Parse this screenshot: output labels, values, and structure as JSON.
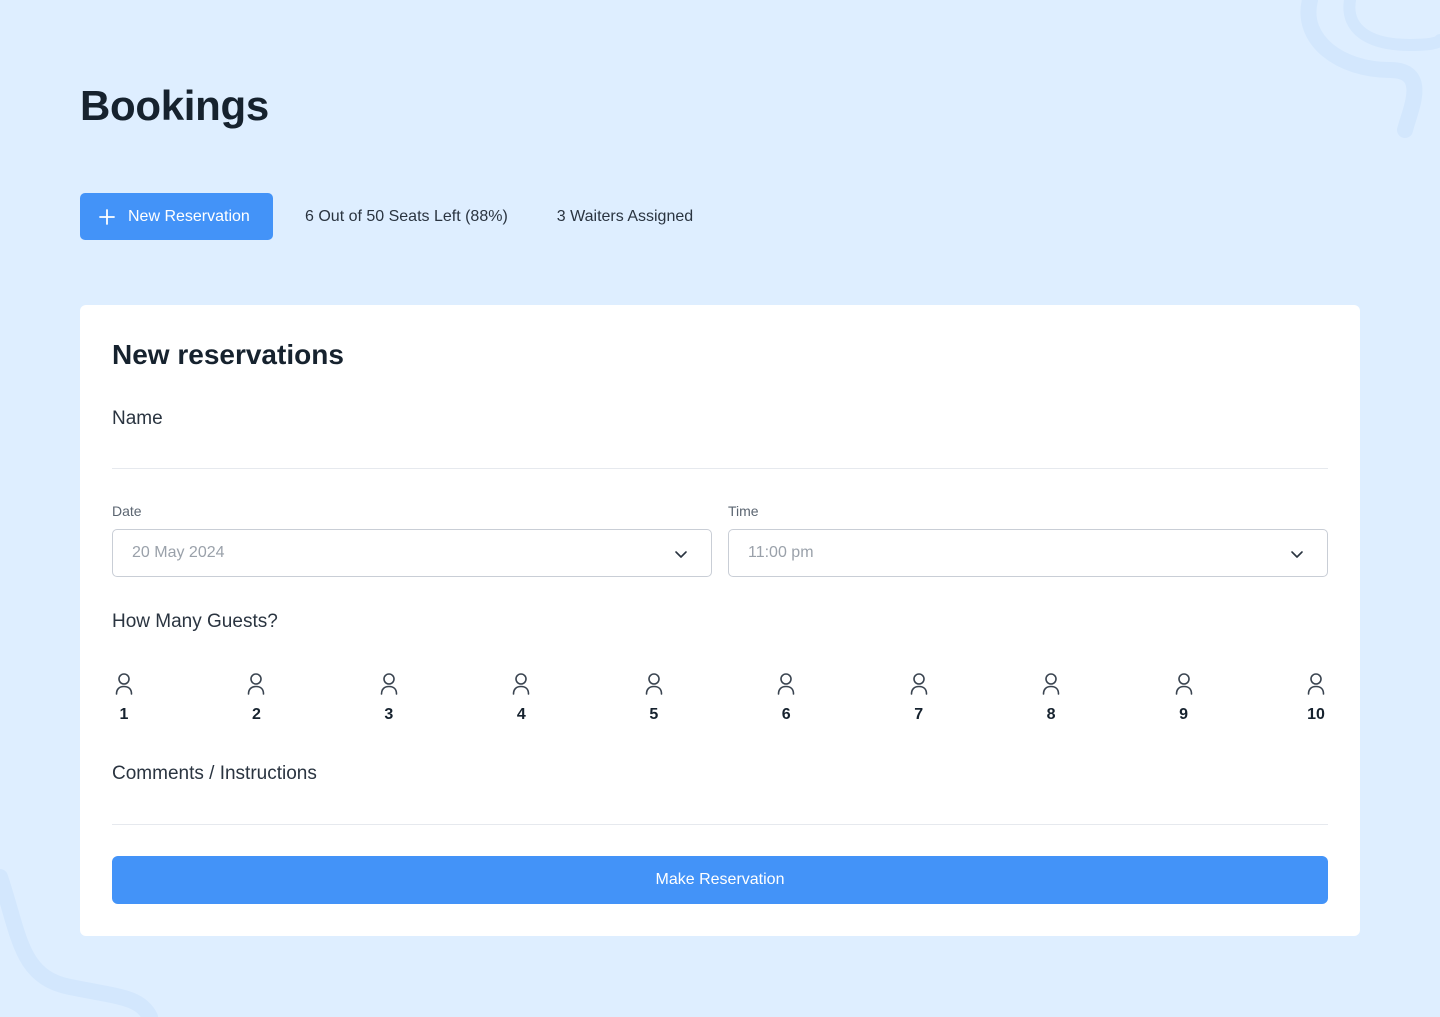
{
  "header": {
    "title": "Bookings"
  },
  "toolbar": {
    "new_reservation_label": "New Reservation",
    "seats_left": "6 Out of 50 Seats Left (88%)",
    "waiters_assigned": "3 Waiters Assigned"
  },
  "form": {
    "title": "New reservations",
    "name_label": "Name",
    "date_label": "Date",
    "date_value": "20 May 2024",
    "time_label": "Time",
    "time_value": "11:00 pm",
    "guests_label": "How Many Guests?",
    "guest_options": [
      "1",
      "2",
      "3",
      "4",
      "5",
      "6",
      "7",
      "8",
      "9",
      "10"
    ],
    "comments_label": "Comments / Instructions",
    "submit_label": "Make Reservation"
  },
  "icons": {
    "new_reservation": "plus-icon",
    "select_arrow": "chevron-down-icon",
    "guest": "person-icon"
  },
  "colors": {
    "accent": "#4393f8",
    "background": "#deeeff",
    "card": "#ffffff"
  }
}
